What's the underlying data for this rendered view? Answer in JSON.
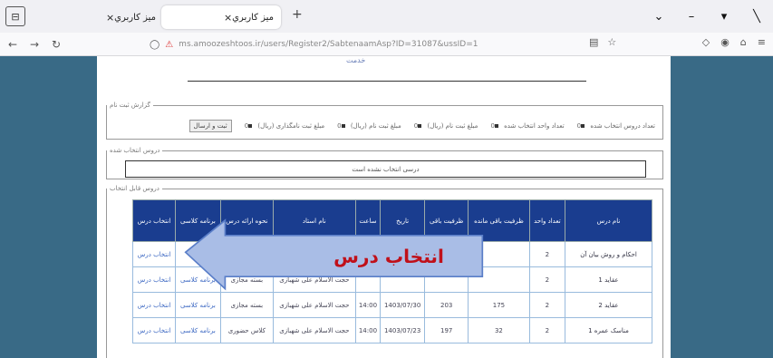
{
  "browser": {
    "tabs": [
      {
        "label": "ميز كاربري"
      },
      {
        "label": "ميز كاربري"
      }
    ],
    "url": "ms.amoozeshtoos.ir/users/Register2/SabtenaamAsp?ID=31087&ussID=1"
  },
  "page": {
    "top_note": "خدمت",
    "report": {
      "legend": "گزارش ثبت نام",
      "items": [
        "تعداد دروس انتخاب شده",
        "تعداد واحد انتخاب شده",
        "مبلغ ثبت نام (ریال)",
        "مبلغ ثبت نام (ریال)",
        "مبلغ ثبت نام (ریال)",
        "مبلغ ثبت نامگذاری (ریال)"
      ],
      "values": [
        "0",
        "0",
        "0",
        "0",
        "0",
        "0"
      ],
      "submit_label": "ثبت و ارسال"
    },
    "selected": {
      "legend": "دروس انتخاب شده",
      "empty_text": "درسی انتخاب نشده است"
    },
    "available": {
      "legend": "دروس قابل انتخاب",
      "headers": [
        "نام درس",
        "تعداد واحد",
        "ظرفیت باقی مانده",
        "ظرفیت باقی",
        "تاریخ",
        "ساعت",
        "نام استاد",
        "نحوه ارائه درس",
        "برنامه کلاسی",
        "انتخاب درس"
      ],
      "rows": [
        {
          "name": "احکام و روش بیان آن",
          "units": "2",
          "cap1": "",
          "cap2": "",
          "date": "",
          "time": "",
          "teacher": "",
          "mode": "",
          "plan": "",
          "select": "انتخاب درس"
        },
        {
          "name": "عقاید 1",
          "units": "2",
          "cap1": "",
          "cap2": "",
          "date": "",
          "time": "",
          "teacher": "حجت الاسلام علی شهبازی",
          "mode": "بسته مجازی",
          "plan": "برنامه کلاسی",
          "select": "انتخاب درس"
        },
        {
          "name": "عقاید 2",
          "units": "2",
          "cap1": "175",
          "cap2": "203",
          "date": "1403/07/30",
          "time": "14:00",
          "teacher": "حجت الاسلام علی شهبازی",
          "mode": "بسته مجازی",
          "plan": "برنامه کلاسی",
          "select": "انتخاب درس"
        },
        {
          "name": "مناسک عمره 1",
          "units": "2",
          "cap1": "32",
          "cap2": "197",
          "date": "1403/07/23",
          "time": "14:00",
          "teacher": "حجت الاسلام علی شهبازی",
          "mode": "کلاس حضوری",
          "plan": "برنامه کلاسی",
          "select": "انتخاب درس"
        }
      ]
    }
  },
  "callout": {
    "text": "انتخاب درس",
    "fill": "#a9bde6",
    "stroke": "#5a7ec8"
  }
}
